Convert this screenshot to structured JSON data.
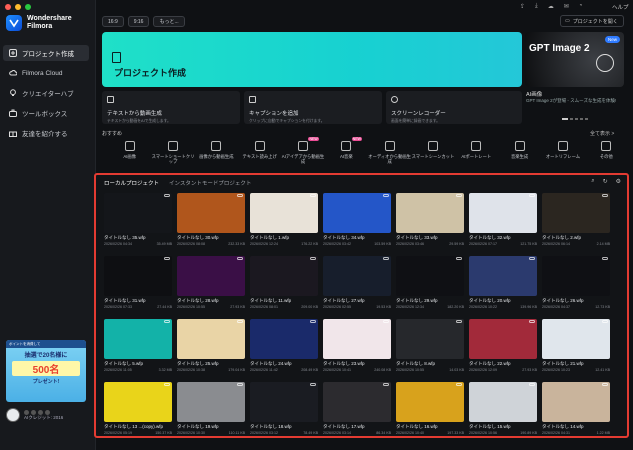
{
  "app": {
    "name_line1": "Wondershare",
    "name_line2": "Filmora"
  },
  "sidebar": {
    "items": [
      {
        "label": "プロジェクト作成",
        "icon": "plus-square-icon"
      },
      {
        "label": "Filmora Cloud",
        "icon": "cloud-icon"
      },
      {
        "label": "クリエイターハブ",
        "icon": "bulb-icon"
      },
      {
        "label": "ツールボックス",
        "icon": "toolbox-icon"
      },
      {
        "label": "友達を紹介する",
        "icon": "gift-icon"
      }
    ],
    "promo": {
      "line1": "ポイントを消費して",
      "line2": "抽選で20名様に",
      "big": "500名",
      "line3": "プレゼント!"
    },
    "user_plan": "AIクレジット: 2016"
  },
  "topbar": {
    "aspect": "16:9",
    "ratio": "9:16",
    "more": "もっと...",
    "open_project": "プロジェクトを開く",
    "help": "ヘルプ"
  },
  "create": {
    "label": "プロジェクト作成"
  },
  "banner": {
    "title": "GPT Image 2",
    "new": "New",
    "caption": "AI画像",
    "desc": "GPT Image 2が登場 - スムーズな生成を体験!"
  },
  "subcards": [
    {
      "title": "テキストから動画生成",
      "desc": "テキストから動画をAIで生成します。"
    },
    {
      "title": "キャプションを追加",
      "desc": "クリップに自動でキャプションを付けます。"
    },
    {
      "title": "スクリーンレコーダー",
      "desc": "画面を簡単に録画できます。"
    }
  ],
  "recommended": {
    "label": "おすすめ",
    "show_all": "全て表示 >"
  },
  "tools": [
    {
      "label": "AI画像",
      "badge": ""
    },
    {
      "label": "スマートショートクリップ",
      "badge": ""
    },
    {
      "label": "画像から動画生成",
      "badge": ""
    },
    {
      "label": "テキスト読み上げ",
      "badge": ""
    },
    {
      "label": "AIアイデアから動画生成",
      "badge": "NEW"
    },
    {
      "label": "AI音楽",
      "badge": "NEW"
    },
    {
      "label": "オーディオから動画生成",
      "badge": ""
    },
    {
      "label": "スマートシーンカット",
      "badge": ""
    },
    {
      "label": "AIポートレート",
      "badge": ""
    },
    {
      "label": "音楽生成",
      "badge": ""
    },
    {
      "label": "オートリフレーム",
      "badge": ""
    },
    {
      "label": "その他",
      "badge": ""
    }
  ],
  "projects_panel": {
    "tabs": [
      "ローカルプロジェクト",
      "インスタントモードプロジェクト"
    ],
    "cards": [
      {
        "name": "タイトルなし 35.wfp",
        "date": "2026/02/26 04:34",
        "size": "35.49 MB",
        "bg": "#14161a"
      },
      {
        "name": "タイトルなし 30.wfp",
        "date": "2026/02/26 08:08",
        "size": "232.33 KB",
        "bg": "#b0561c"
      },
      {
        "name": "タイトルなし 1.wfp",
        "date": "2026/02/26 12:24",
        "size": "176.22 KB",
        "bg": "#e8e2d8"
      },
      {
        "name": "タイトルなし 34.wfp",
        "date": "2026/02/26 03:42",
        "size": "103.59 KB",
        "bg": "#2456c8"
      },
      {
        "name": "タイトルなし 33.wfp",
        "date": "2026/02/26 03:46",
        "size": "29.59 KB",
        "bg": "#cfc2a6"
      },
      {
        "name": "タイトルなし 32.wfp",
        "date": "2026/02/26 07:17",
        "size": "121.75 KB",
        "bg": "#dfe3ea"
      },
      {
        "name": "タイトルなし 2.wfp",
        "date": "2026/02/26 06:14",
        "size": "2.14 MB",
        "bg": "#2b2620"
      },
      {
        "name": "タイトルなし 31.wfp",
        "date": "2026/02/26 07:33",
        "size": "27.44 KB",
        "bg": "#0e0f12"
      },
      {
        "name": "タイトルなし 28.wfp",
        "date": "2026/02/26 10:55",
        "size": "27.93 KB",
        "bg": "#3a0f46"
      },
      {
        "name": "タイトルなし 11.wfp",
        "date": "2026/02/26 08:01",
        "size": "209.00 KB",
        "bg": "#1b1820"
      },
      {
        "name": "タイトルなし 27.wfp",
        "date": "2026/02/26 02:55",
        "size": "19.53 KB",
        "bg": "#171e2c"
      },
      {
        "name": "タイトルなし 29.wfp",
        "date": "2026/02/26 12:34",
        "size": "182.20 KB",
        "bg": "#0f1014"
      },
      {
        "name": "タイトルなし 20.wfp",
        "date": "2026/02/26 10:22",
        "size": "139.96 KB",
        "bg": "#2b3a6e"
      },
      {
        "name": "タイトルなし 26.wfp",
        "date": "2026/02/26 04:37",
        "size": "12.73 KB",
        "bg": "#0f1014"
      },
      {
        "name": "タイトルなし 5.wfp",
        "date": "2026/02/26 11:05",
        "size": "3.32 MB",
        "bg": "#13b2a8"
      },
      {
        "name": "タイトルなし 25.wfp",
        "date": "2026/02/26 10:38",
        "size": "179.04 KB",
        "bg": "#e9d4a6"
      },
      {
        "name": "タイトルなし 24.wfp",
        "date": "2026/02/26 11:42",
        "size": "208.49 KB",
        "bg": "#1a2a6a"
      },
      {
        "name": "タイトルなし 23.wfp",
        "date": "2026/02/26 10:41",
        "size": "240.08 KB",
        "bg": "#f1e6ea"
      },
      {
        "name": "タイトルなし 8.wfp",
        "date": "2026/02/26 10:55",
        "size": "14.03 KB",
        "bg": "#26282c"
      },
      {
        "name": "タイトルなし 22.wfp",
        "date": "2026/02/26 12:09",
        "size": "27.93 KB",
        "bg": "#a22a3a"
      },
      {
        "name": "タイトルなし 21.wfp",
        "date": "2026/02/26 10:23",
        "size": "12.41 KB",
        "bg": "#e0e6ec"
      },
      {
        "name": "タイトルなし 13 ...(copy).wfp",
        "date": "2026/02/26 05:19",
        "size": "150.37 KB",
        "bg": "#e9d41a"
      },
      {
        "name": "タイトルなし 19.wfp",
        "date": "2026/02/26 10:30",
        "size": "110.11 KB",
        "bg": "#8a8c90"
      },
      {
        "name": "タイトルなし 18.wfp",
        "date": "2026/02/26 03:12",
        "size": "78.49 KB",
        "bg": "#1a1c22"
      },
      {
        "name": "タイトルなし 17.wfp",
        "date": "2026/02/26 03:14",
        "size": "86.34 KB",
        "bg": "#2c2b2f"
      },
      {
        "name": "タイトルなし 16.wfp",
        "date": "2026/02/26 10:40",
        "size": "197.33 KB",
        "bg": "#d8a21c"
      },
      {
        "name": "タイトルなし 15.wfp",
        "date": "2026/02/26 10:56",
        "size": "190.89 KB",
        "bg": "#cfd3d8"
      },
      {
        "name": "タイトルなし 14.wfp",
        "date": "2026/02/26 04:31",
        "size": "1.22 MB",
        "bg": "#c9b49c"
      }
    ]
  },
  "colors": {
    "accent": "#1fe0c8",
    "highlight_border": "#e33b32"
  }
}
